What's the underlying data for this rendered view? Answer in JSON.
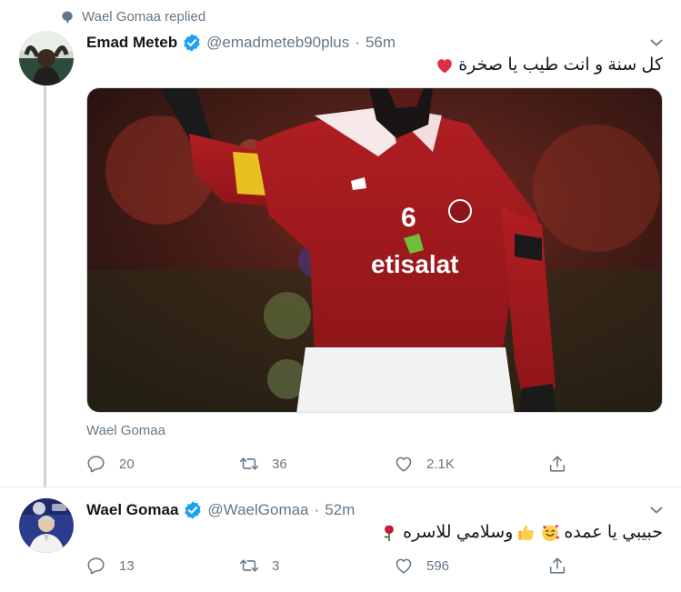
{
  "colors": {
    "accent": "#1da1f2",
    "secondary_text": "#657786",
    "heart_red": "#e0245e",
    "thread_line": "#ccd6dd"
  },
  "tweets": [
    {
      "social_context": "Wael Gomaa replied",
      "social_context_icon": "comment-bubble-icon",
      "display_name": "Emad Meteb",
      "handle": "@emadmeteb90plus",
      "separator": "·",
      "time": "56m",
      "verified": true,
      "text": "كل سنة و انت طيب يا صخرة",
      "text_emoji": [
        "red-heart"
      ],
      "media_credit": "Wael Gomaa",
      "media_description": "Soccer player in red Al Ahly jersey number 6 with yellow captain armband",
      "media_text": {
        "sponsor": "etisalat",
        "jersey_number": "6"
      },
      "stats": {
        "replies": "20",
        "retweets": "36",
        "likes": "2.1K"
      }
    },
    {
      "display_name": "Wael Gomaa",
      "handle": "@WaelGomaa",
      "separator": "·",
      "time": "52m",
      "verified": true,
      "text": "حبيبي يا عمده",
      "text_2": "وسلامي للاسره",
      "text_emoji": [
        "smiling-face-with-hearts",
        "thumbs-up",
        "rose"
      ],
      "stats": {
        "replies": "13",
        "retweets": "3",
        "likes": "596"
      }
    }
  ]
}
